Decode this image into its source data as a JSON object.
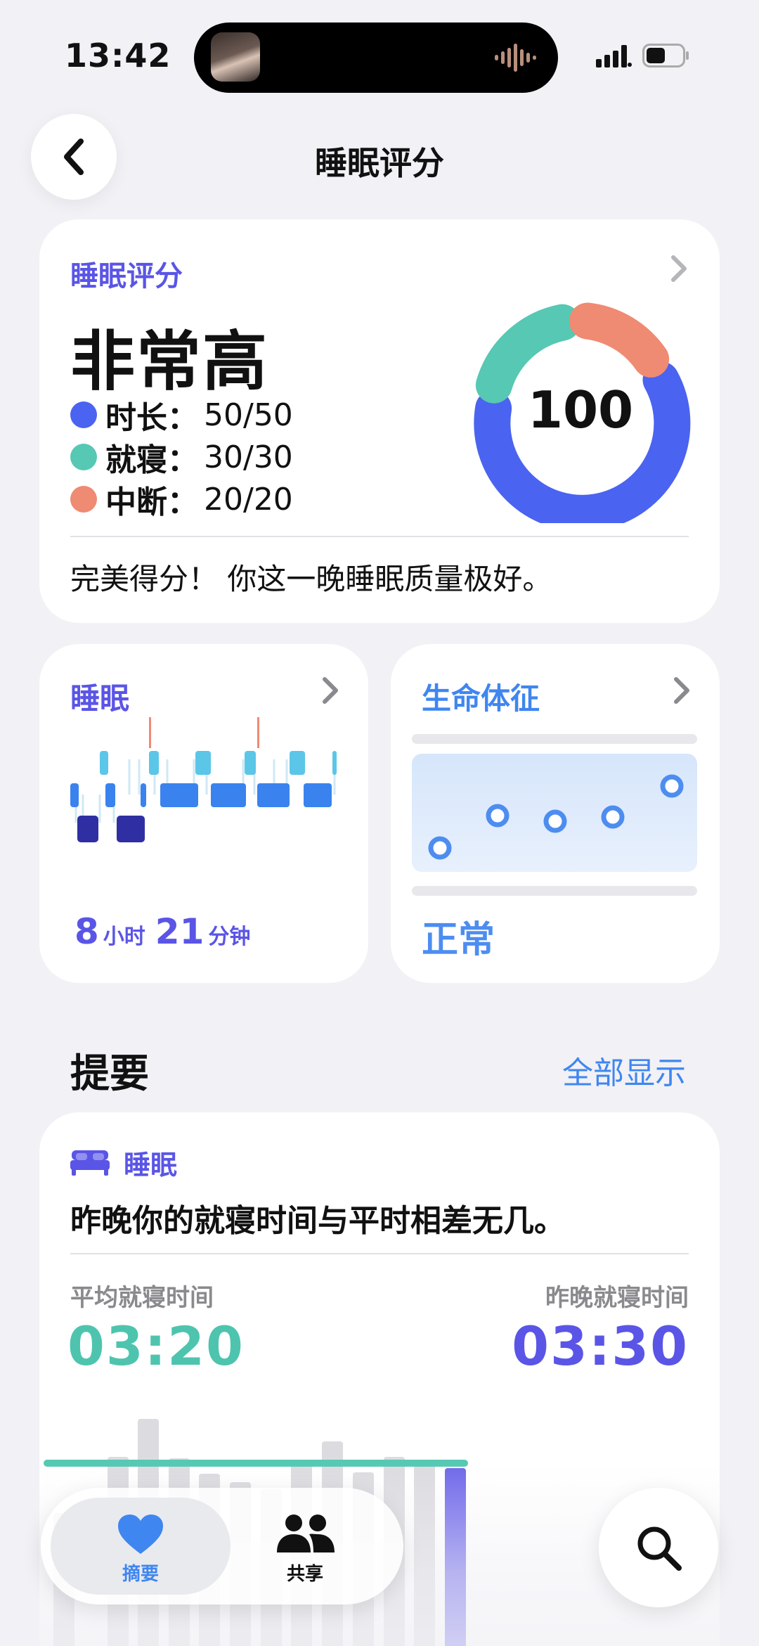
{
  "status_bar": {
    "time": "13:42"
  },
  "nav": {
    "title": "睡眠评分"
  },
  "score_card": {
    "label": "睡眠评分",
    "rating": "非常高",
    "score": "100",
    "items": [
      {
        "name": "时长：",
        "value": "50/50",
        "color": "#4a63f0"
      },
      {
        "name": "就寝：",
        "value": "30/30",
        "color": "#56c8b3"
      },
      {
        "name": "中断：",
        "value": "20/20",
        "color": "#ef8a73"
      }
    ],
    "note": "完美得分！ 你这一晚睡眠质量极好。"
  },
  "sleep_card": {
    "label": "睡眠",
    "hours": "8",
    "hours_unit": "小时",
    "minutes": "21",
    "minutes_unit": "分钟"
  },
  "vitals_card": {
    "label": "生命体征",
    "status": "正常"
  },
  "highlights": {
    "title": "提要",
    "show_all": "全部显示",
    "category": "睡眠",
    "text": "昨晚你的就寝时间与平时相差无几。",
    "avg_label": "平均就寝时间",
    "avg_value": "03:20",
    "last_label": "昨晚就寝时间",
    "last_value": "03:30"
  },
  "tabbar": {
    "summary": "摘要",
    "share": "共享"
  },
  "colors": {
    "accent": "#5a55e6",
    "blue": "#3f86f0",
    "teal": "#56c8b3",
    "coral": "#ef8a73",
    "duration_blue": "#4a63f0"
  },
  "icons": [
    "back-chevron-icon",
    "chevron-right-icon",
    "bed-icon",
    "heart-icon",
    "people-icon",
    "search-icon"
  ]
}
